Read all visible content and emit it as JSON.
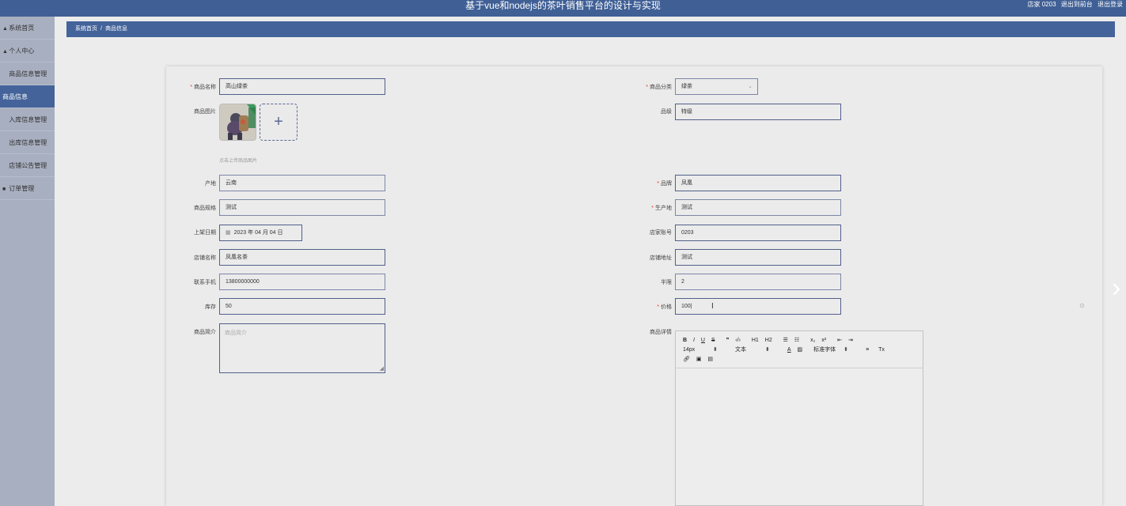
{
  "header": {
    "title": "基于vue和nodejs的茶叶销售平台的设计与实现",
    "user": "店家 0203",
    "back_to_front": "退出到前台",
    "logout": "退出登录"
  },
  "sidebar": {
    "items": [
      {
        "label": "系统首页",
        "icon": "home-icon",
        "glyph": "▲"
      },
      {
        "label": "个人中心",
        "icon": "user-icon",
        "glyph": "▲"
      },
      {
        "label": "商品信息管理",
        "icon": "",
        "glyph": ""
      },
      {
        "label": "商品信息",
        "icon": "",
        "glyph": ""
      },
      {
        "label": "入库信息管理",
        "icon": "",
        "glyph": ""
      },
      {
        "label": "出库信息管理",
        "icon": "",
        "glyph": ""
      },
      {
        "label": "店铺公告管理",
        "icon": "",
        "glyph": ""
      },
      {
        "label": "订单管理",
        "icon": "order-icon",
        "glyph": "■"
      }
    ],
    "active_index": 3,
    "active_color": "#44639a"
  },
  "breadcrumb": {
    "home": "系统首页",
    "separator": "/",
    "current": "商品信息"
  },
  "form": {
    "name": {
      "label": "商品名称",
      "value": "高山绿茶",
      "required": true
    },
    "category": {
      "label": "商品分类",
      "value": "绿茶",
      "required": true
    },
    "image": {
      "label": "商品图片",
      "hint": "点击上传商品图片"
    },
    "grade": {
      "label": "品级",
      "value": "特级"
    },
    "origin": {
      "label": "产地",
      "value": "云南"
    },
    "brand": {
      "label": "品牌",
      "value": "凤凰",
      "required": true
    },
    "spec": {
      "label": "商品规格",
      "value": "测试"
    },
    "producer": {
      "label": "生产地",
      "value": "测试",
      "required": true
    },
    "launch_date": {
      "label": "上架日期",
      "value": "2023 年 04 月 04 日"
    },
    "shop_account": {
      "label": "店家账号",
      "value": "0203"
    },
    "shop_name": {
      "label": "店铺名称",
      "value": "凤凰名茶"
    },
    "shop_addr": {
      "label": "店铺地址",
      "value": "测试"
    },
    "phone": {
      "label": "联系手机",
      "value": "13800000000"
    },
    "quota": {
      "label": "半限",
      "value": "2"
    },
    "stock": {
      "label": "库存",
      "value": "50"
    },
    "price": {
      "label": "价格",
      "value": "100|",
      "required": true
    },
    "intro": {
      "label": "商品简介",
      "placeholder": "商品简介"
    },
    "detail": {
      "label": "商品详情"
    }
  },
  "editor": {
    "row1": [
      "B",
      "I",
      "U",
      "S",
      "❞",
      "‹/›",
      "H1",
      "H2",
      "☰",
      "☷",
      "x₂",
      "x²",
      "⇤",
      "⇥"
    ],
    "font_size": "14px",
    "font_text": "文本",
    "font_family": "标准字体",
    "clear_glyph": "Tx"
  },
  "colors": {
    "header_bg": "#3f5f95",
    "breadcrumb_bg": "#44639a",
    "sidebar_bg": "#a8afc0",
    "required": "#ee3333"
  }
}
